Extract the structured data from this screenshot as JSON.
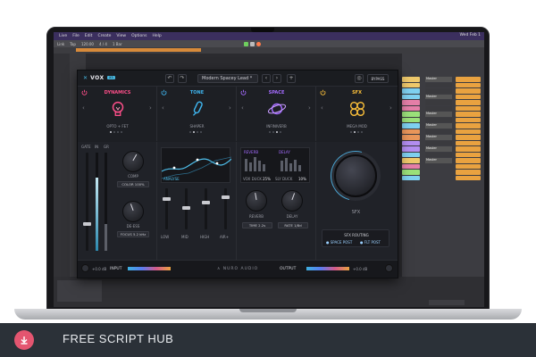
{
  "menubar": {
    "items": [
      "Live",
      "File",
      "Edit",
      "Create",
      "View",
      "Options",
      "Help"
    ],
    "right_text": "Wed Feb 1"
  },
  "toolbar": {
    "left": "Link",
    "tap": "Tap",
    "tempo": "120.00",
    "sig": "4 / 4",
    "bar": "1 Bar"
  },
  "colors": {
    "menubar": "#3b2f5e",
    "accent": "#46b4dc",
    "dynamics": "#ff4f8a",
    "tone": "#3fb6f0",
    "space": "#a46bff",
    "sfx": "#ffc23a"
  },
  "plugin": {
    "logo": "VOX",
    "logo_badge": "X3",
    "preset": "Modern Spacey Lead *",
    "bypass": "BYPASS",
    "modules": [
      {
        "title": "DYNAMICS",
        "sub": "OPTO + FET",
        "icon": "bulb-icon"
      },
      {
        "title": "TONE",
        "sub": "SHAPER",
        "icon": "tube-icon"
      },
      {
        "title": "SPACE",
        "sub": "INFINIVERB",
        "icon": "planet-icon"
      },
      {
        "title": "SFX",
        "sub": "MEGA MOD",
        "icon": "clover-icon"
      }
    ],
    "dynamics": {
      "meter_labels": [
        "GATE",
        "IN",
        "GR"
      ],
      "comp_label": "COMP",
      "comp_value": "COLOR 100%",
      "deess_label": "DE-ESS",
      "deess_value": "FOCUS 5.2 kHz"
    },
    "tone": {
      "eq_label": "ANALYSE",
      "faders": [
        "LOW",
        "MID",
        "HIGH",
        "AIR+"
      ]
    },
    "space": {
      "reverb_tag": "REVERB",
      "delay_tag": "DELAY",
      "vox_duck": "VOX DUCK",
      "vox_duck_val": "25%",
      "sly_duck": "SLY DUCK",
      "sly_duck_val": "10%",
      "reverb_label": "REVERB",
      "delay_label": "DELAY",
      "time_label": "TIME",
      "time_val": "2.2s",
      "rate_label": "RATE",
      "rate_val": "1/8d"
    },
    "sfx": {
      "label": "SFX",
      "routing_title": "SFX ROUTING",
      "route_a": "SPACE POST",
      "route_b": "FLT POST"
    },
    "footer": {
      "input_val": "+0.0 dB",
      "input_label": "INPUT",
      "brand": "NURO AUDIO",
      "output_label": "OUTPUT",
      "output_val": "+0.0 dB"
    }
  },
  "daw_mixer": {
    "track_names": [
      "Master",
      "Master",
      "Master",
      "Master",
      "Master",
      "Master",
      "Master"
    ]
  },
  "banner": {
    "text": "FREE SCRIPT HUB"
  }
}
